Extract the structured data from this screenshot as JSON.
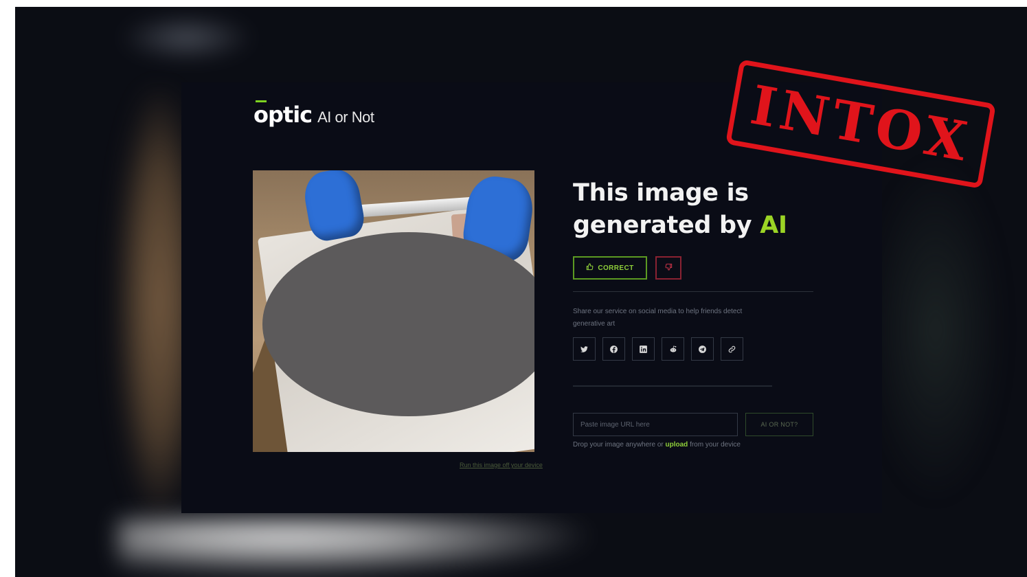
{
  "app": {
    "logo_mark": "optic",
    "logo_sub": "AI or Not"
  },
  "result": {
    "headline_prefix": "This image is generated by ",
    "headline_highlight": "AI",
    "correct_label": "CORRECT",
    "wrong_icon": "thumbs-down-icon",
    "correct_icon": "thumbs-up-icon"
  },
  "image": {
    "credit": "Run this image off your device"
  },
  "share": {
    "text": "Share our service on social media to help friends detect generative art",
    "icons": [
      "twitter-icon",
      "facebook-icon",
      "linkedin-icon",
      "reddit-icon",
      "telegram-icon",
      "link-icon"
    ]
  },
  "form": {
    "url_placeholder": "Paste image URL here",
    "submit_label": "AI OR NOT?",
    "drop_prefix": "Drop your image anywhere or ",
    "drop_link": "upload",
    "drop_suffix": " from your device"
  },
  "overlay": {
    "stamp_text": "INTOX"
  },
  "colors": {
    "accent_green": "#9bd425",
    "stamp_red": "#e0141b",
    "background": "#0a0c16"
  }
}
